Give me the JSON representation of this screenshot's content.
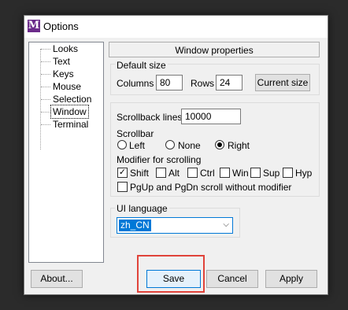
{
  "window": {
    "title": "Options",
    "app_icon_letter": "M"
  },
  "tree": {
    "items": [
      "Looks",
      "Text",
      "Keys",
      "Mouse",
      "Selection",
      "Window",
      "Terminal"
    ],
    "selected": "Window"
  },
  "panel_title": "Window properties",
  "default_size": {
    "legend": "Default size",
    "columns_label": "Columns",
    "columns_value": "80",
    "rows_label": "Rows",
    "rows_value": "24",
    "current_size_button": "Current size"
  },
  "scrollback": {
    "label": "Scrollback lines",
    "value": "10000"
  },
  "scrollbar": {
    "label": "Scrollbar",
    "options": [
      "Left",
      "None",
      "Right"
    ],
    "selected": "Right"
  },
  "modifier": {
    "label": "Modifier for scrolling",
    "options": [
      "Shift",
      "Alt",
      "Ctrl",
      "Win",
      "Sup",
      "Hyp"
    ],
    "checked": [
      "Shift"
    ],
    "pgup_label": "PgUp and PgDn scroll without modifier"
  },
  "ui_language": {
    "legend": "UI language",
    "value": "zh_CN"
  },
  "buttons": {
    "about": "About...",
    "save": "Save",
    "cancel": "Cancel",
    "apply": "Apply"
  },
  "colors": {
    "accent": "#0078d7",
    "highlight": "#e0433a",
    "app_icon": "#6b2b8a"
  }
}
